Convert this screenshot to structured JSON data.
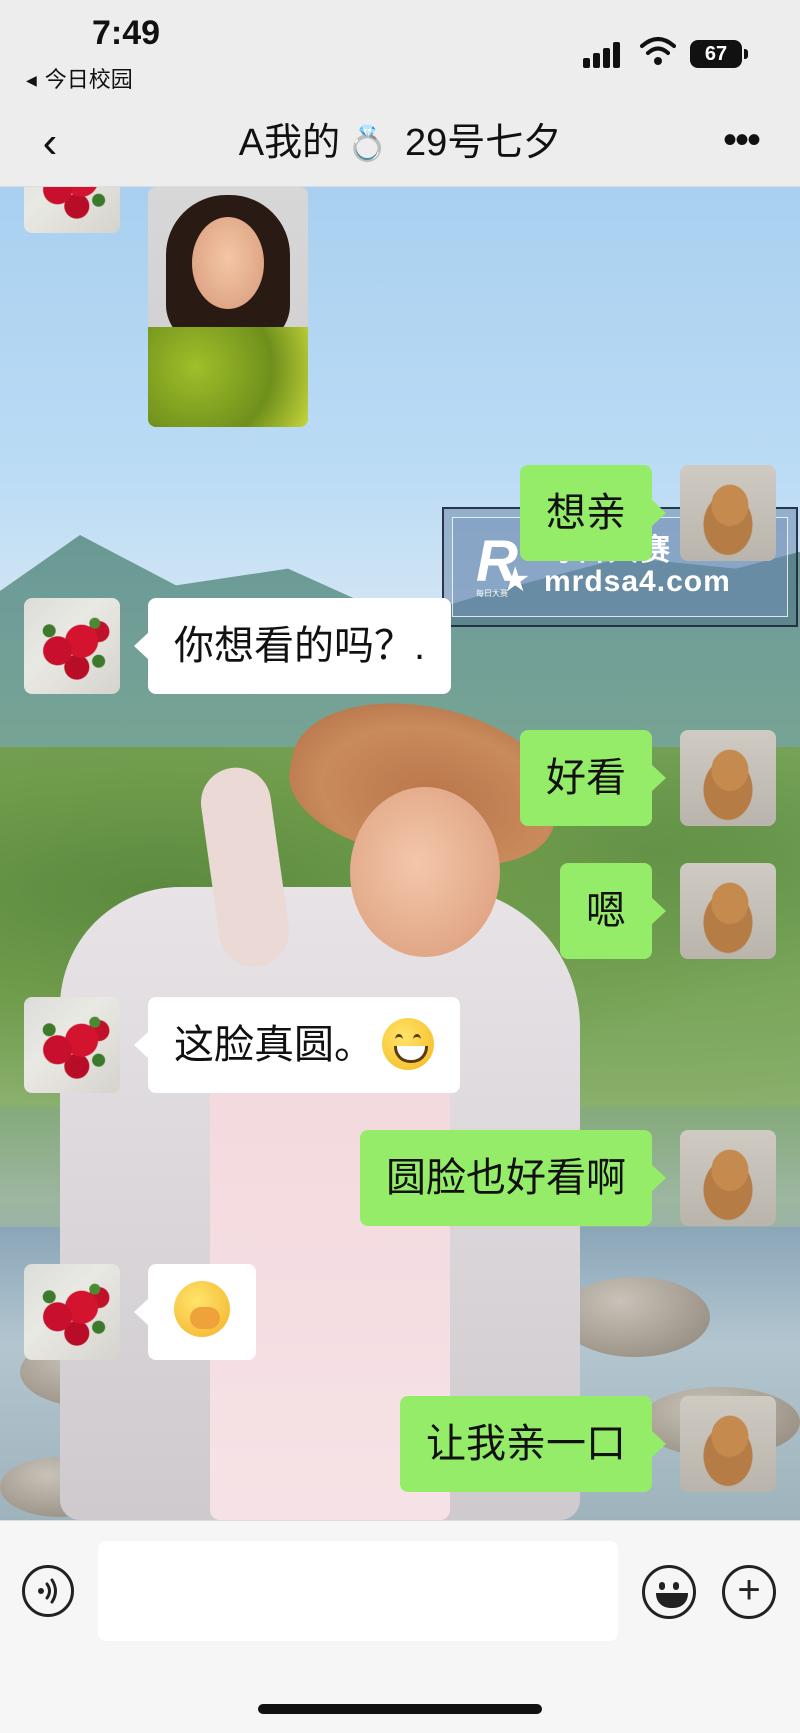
{
  "status_bar": {
    "time": "7:49",
    "back_app": "今日校园",
    "battery": "67",
    "icons": [
      "cellular-signal-icon",
      "wifi-icon",
      "battery-icon"
    ]
  },
  "nav": {
    "back_icon": "‹",
    "title_prefix": "A我的",
    "title_ring": "💍",
    "title_suffix": " 29号七夕",
    "more_icon": "•••"
  },
  "watermark": {
    "logo_letter": "R",
    "logo_star": "★",
    "logo_mini": "每日大赛",
    "name": "每日大赛",
    "url": "mrdsa4.com"
  },
  "messages": [
    {
      "side": "left",
      "type": "image",
      "content": "photo"
    },
    {
      "side": "right",
      "type": "text",
      "text": "想亲"
    },
    {
      "side": "left",
      "type": "text",
      "text": "你想看的吗？."
    },
    {
      "side": "right",
      "type": "text",
      "text": "好看"
    },
    {
      "side": "right",
      "type": "text",
      "text": "嗯"
    },
    {
      "side": "left",
      "type": "text",
      "text": "这脸真圆。",
      "emoji": "grinning-face"
    },
    {
      "side": "right",
      "type": "text",
      "text": "圆脸也好看啊"
    },
    {
      "side": "left",
      "type": "emoji",
      "emoji": "face-with-hand-over-mouth"
    },
    {
      "side": "right",
      "type": "text",
      "text": "让我亲一口"
    }
  ],
  "input": {
    "placeholder": "",
    "voice_icon": "voice-icon",
    "emoji_icon": "emoji-icon",
    "plus_icon": "+"
  }
}
